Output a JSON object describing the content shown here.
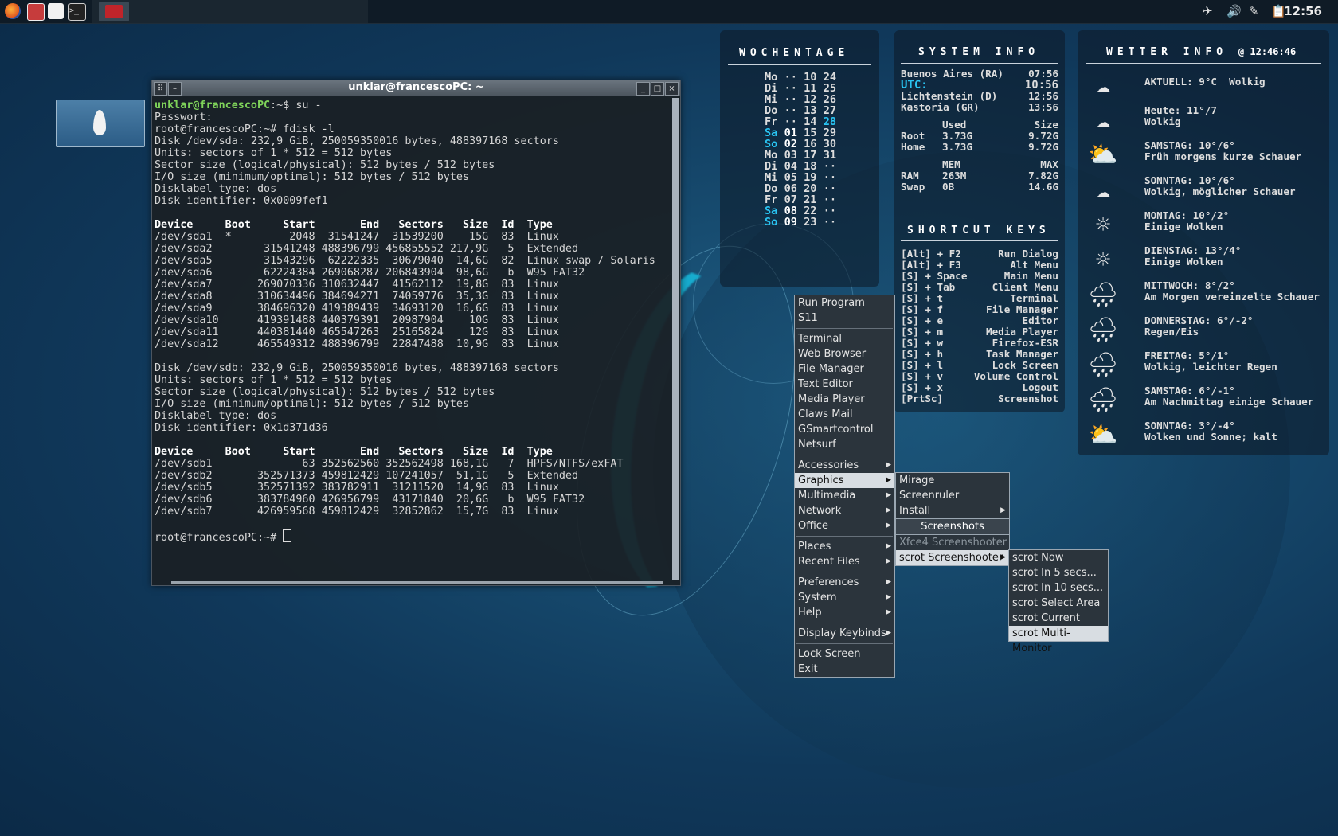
{
  "panel": {
    "launchers": [
      "firefox-icon",
      "app-icon",
      "text-editor-icon",
      "terminal-icon"
    ],
    "clock": "12:56"
  },
  "terminal": {
    "title": "unklar@francescoPC: ~",
    "prompt_user": "unklar@francescoPC",
    "prompt_rest": ":~$ su -",
    "lines": [
      "Passwort:",
      "root@francescoPC:~# fdisk -l",
      "Disk /dev/sda: 232,9 GiB, 250059350016 bytes, 488397168 sectors",
      "Units: sectors of 1 * 512 = 512 bytes",
      "Sector size (logical/physical): 512 bytes / 512 bytes",
      "I/O size (minimum/optimal): 512 bytes / 512 bytes",
      "Disklabel type: dos",
      "Disk identifier: 0x0009fef1",
      "",
      "Device     Boot     Start       End   Sectors   Size  Id  Type",
      "/dev/sda1  *         2048  31541247  31539200    15G  83  Linux",
      "/dev/sda2        31541248 488396799 456855552 217,9G   5  Extended",
      "/dev/sda5        31543296  62222335  30679040  14,6G  82  Linux swap / Solaris",
      "/dev/sda6        62224384 269068287 206843904  98,6G   b  W95 FAT32",
      "/dev/sda7       269070336 310632447  41562112  19,8G  83  Linux",
      "/dev/sda8       310634496 384694271  74059776  35,3G  83  Linux",
      "/dev/sda9       384696320 419389439  34693120  16,6G  83  Linux",
      "/dev/sda10      419391488 440379391  20987904    10G  83  Linux",
      "/dev/sda11      440381440 465547263  25165824    12G  83  Linux",
      "/dev/sda12      465549312 488396799  22847488  10,9G  83  Linux",
      "",
      "Disk /dev/sdb: 232,9 GiB, 250059350016 bytes, 488397168 sectors",
      "Units: sectors of 1 * 512 = 512 bytes",
      "Sector size (logical/physical): 512 bytes / 512 bytes",
      "I/O size (minimum/optimal): 512 bytes / 512 bytes",
      "Disklabel type: dos",
      "Disk identifier: 0x1d371d36",
      "",
      "Device     Boot     Start       End   Sectors   Size  Id  Type",
      "/dev/sdb1              63 352562560 352562498 168,1G   7  HPFS/NTFS/exFAT",
      "/dev/sdb2       352571373 459812429 107241057  51,1G   5  Extended",
      "/dev/sdb5       352571392 383782911  31211520  14,9G  83  Linux",
      "/dev/sdb6       383784960 426956799  43171840  20,6G   b  W95 FAT32",
      "/dev/sdb7       426959568 459812429  32852862  15,7G  83  Linux",
      ""
    ],
    "final_prompt": "root@francescoPC:~# "
  },
  "calendar": {
    "title": "WOCHENTAGE",
    "rows": [
      {
        "d": "Mo",
        "a": "··",
        "b": "10",
        "c": "24"
      },
      {
        "d": "Di",
        "a": "··",
        "b": "11",
        "c": "25"
      },
      {
        "d": "Mi",
        "a": "··",
        "b": "12",
        "c": "26"
      },
      {
        "d": "Do",
        "a": "··",
        "b": "13",
        "c": "27"
      },
      {
        "d": "Fr",
        "a": "··",
        "b": "14",
        "c": "28"
      },
      {
        "d": "Sa",
        "a": "01",
        "b": "15",
        "c": "29"
      },
      {
        "d": "So",
        "a": "02",
        "b": "16",
        "c": "30"
      },
      {
        "d": "Mo",
        "a": "03",
        "b": "17",
        "c": "31"
      },
      {
        "d": "Di",
        "a": "04",
        "b": "18",
        "c": "··"
      },
      {
        "d": "Mi",
        "a": "05",
        "b": "19",
        "c": "··"
      },
      {
        "d": "Do",
        "a": "06",
        "b": "20",
        "c": "··"
      },
      {
        "d": "Fr",
        "a": "07",
        "b": "21",
        "c": "··"
      },
      {
        "d": "Sa",
        "a": "08",
        "b": "22",
        "c": "··"
      },
      {
        "d": "So",
        "a": "09",
        "b": "23",
        "c": "··"
      }
    ],
    "highlight_color": "#29c4f2"
  },
  "sysinfo": {
    "title": "SYSTEM INFO",
    "clocks": [
      {
        "l": "Buenos Aires (RA)",
        "r": "07:56"
      },
      {
        "l": "UTC:",
        "r": "10:56"
      },
      {
        "l": "Lichtenstein (D)",
        "r": "12:56"
      },
      {
        "l": "Kastoria (GR)",
        "r": "13:56"
      }
    ],
    "disk_header": {
      "a": "Used",
      "b": "Size"
    },
    "disks": [
      {
        "l": "Root",
        "a": "3.73G",
        "b": "9.72G"
      },
      {
        "l": "Home",
        "a": "3.73G",
        "b": "9.72G"
      }
    ],
    "mem_header": {
      "a": "MEM",
      "b": "MAX"
    },
    "mems": [
      {
        "l": "RAM",
        "a": "263M",
        "b": "7.82G"
      },
      {
        "l": "Swap",
        "a": "0B",
        "b": "14.6G"
      }
    ],
    "shortcut_title": "SHORTCUT KEYS",
    "shortcuts": [
      {
        "k": "[Alt] + F2",
        "v": "Run Dialog"
      },
      {
        "k": "[Alt] + F3",
        "v": "Alt Menu"
      },
      {
        "k": "[S] + Space",
        "v": "Main Menu"
      },
      {
        "k": "[S] + Tab",
        "v": "Client Menu"
      },
      {
        "k": "[S] + t",
        "v": "Terminal"
      },
      {
        "k": "[S] + f",
        "v": "File Manager"
      },
      {
        "k": "[S] + e",
        "v": "Editor"
      },
      {
        "k": "[S] + m",
        "v": "Media Player"
      },
      {
        "k": "[S] + w",
        "v": "Firefox-ESR"
      },
      {
        "k": "[S] + h",
        "v": "Task Manager"
      },
      {
        "k": "[S] + l",
        "v": "Lock Screen"
      },
      {
        "k": "[S] + v",
        "v": "Volume Control"
      },
      {
        "k": "[S] + x",
        "v": "Logout"
      },
      {
        "k": "[PrtSc]",
        "v": "Screenshot"
      }
    ]
  },
  "weather": {
    "title": "WETTER INFO",
    "time": "@ 12:46:46",
    "items": [
      {
        "icon": "cloud-icon",
        "l1": "AKTUELL: 9°C  Wolkig",
        "l2": ""
      },
      {
        "icon": "cloud-icon",
        "l1": "Heute: 11°/7",
        "l2": "Wolkig"
      },
      {
        "icon": "sun-cloud-icon",
        "l1": "SAMSTAG: 10°/6°",
        "l2": "Früh morgens kurze Schauer"
      },
      {
        "icon": "cloud-icon",
        "l1": "SONNTAG: 10°/6°",
        "l2": "Wolkig, möglicher Schauer"
      },
      {
        "icon": "sun-icon",
        "l1": "MONTAG: 10°/2°",
        "l2": "Einige Wolken"
      },
      {
        "icon": "sun-icon",
        "l1": "DIENSTAG: 13°/4°",
        "l2": "Einige Wolken"
      },
      {
        "icon": "rain-icon",
        "l1": "MITTWOCH: 8°/2°",
        "l2": "Am Morgen vereinzelte Schauer"
      },
      {
        "icon": "rain-icon",
        "l1": "DONNERSTAG: 6°/-2°",
        "l2": "Regen/Eis"
      },
      {
        "icon": "rain-icon",
        "l1": "FREITAG: 5°/1°",
        "l2": "Wolkig, leichter Regen"
      },
      {
        "icon": "rain-icon",
        "l1": "SAMSTAG: 6°/-1°",
        "l2": "Am Nachmittag einige Schauer"
      },
      {
        "icon": "sun-cloud-icon",
        "l1": "SONNTAG: 3°/-4°",
        "l2": "Wolken und Sonne; kalt"
      }
    ]
  },
  "menu_main": [
    {
      "label": "Run Program",
      "type": "item"
    },
    {
      "label": "S11",
      "type": "item"
    },
    {
      "type": "sep"
    },
    {
      "label": "Terminal",
      "type": "item"
    },
    {
      "label": "Web Browser",
      "type": "item"
    },
    {
      "label": "File Manager",
      "type": "item"
    },
    {
      "label": "Text Editor",
      "type": "item"
    },
    {
      "label": "Media Player",
      "type": "item"
    },
    {
      "label": "Claws Mail",
      "type": "item"
    },
    {
      "label": "GSmartcontrol",
      "type": "item"
    },
    {
      "label": "Netsurf",
      "type": "item"
    },
    {
      "type": "sep"
    },
    {
      "label": "Accessories",
      "type": "sub"
    },
    {
      "label": "Graphics",
      "type": "sub",
      "selected": true
    },
    {
      "label": "Multimedia",
      "type": "sub"
    },
    {
      "label": "Network",
      "type": "sub"
    },
    {
      "label": "Office",
      "type": "sub"
    },
    {
      "type": "sep"
    },
    {
      "label": "Places",
      "type": "sub"
    },
    {
      "label": "Recent Files",
      "type": "sub"
    },
    {
      "type": "sep"
    },
    {
      "label": "Preferences",
      "type": "sub"
    },
    {
      "label": "System",
      "type": "sub"
    },
    {
      "label": "Help",
      "type": "sub"
    },
    {
      "type": "sep"
    },
    {
      "label": "Display Keybinds",
      "type": "sub"
    },
    {
      "type": "sep"
    },
    {
      "label": "Lock Screen",
      "type": "item"
    },
    {
      "label": "Exit",
      "type": "item"
    }
  ],
  "menu_graphics": [
    {
      "label": "Mirage",
      "type": "item"
    },
    {
      "label": "Screenruler",
      "type": "item"
    },
    {
      "label": "Install",
      "type": "sub"
    },
    {
      "label": "Screenshots",
      "type": "hdr"
    },
    {
      "label": "Xfce4 Screenshooter",
      "type": "item",
      "dim": true
    },
    {
      "label": "scrot Screenshooter",
      "type": "sub",
      "selected": true
    }
  ],
  "menu_scrot": [
    {
      "label": "scrot Now",
      "type": "item"
    },
    {
      "label": "scrot In 5 secs...",
      "type": "item"
    },
    {
      "label": "scrot In 10 secs...",
      "type": "item"
    },
    {
      "label": "scrot Select Area",
      "type": "item"
    },
    {
      "label": "scrot Current Focus",
      "type": "item"
    },
    {
      "label": "scrot Multi-Monitor",
      "type": "item",
      "selected": true
    }
  ]
}
